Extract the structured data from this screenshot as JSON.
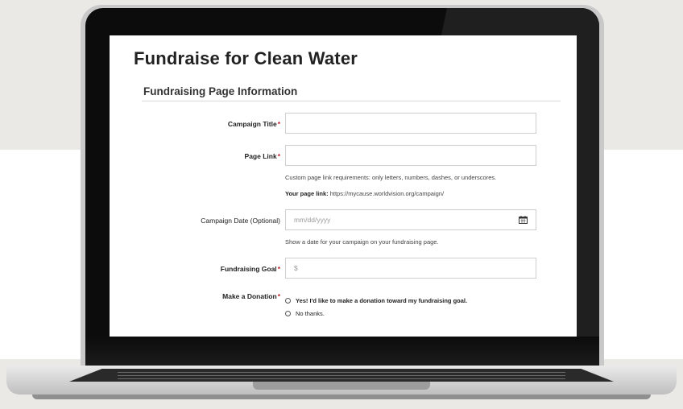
{
  "page": {
    "title": "Fundraise for Clean Water"
  },
  "section": {
    "title": "Fundraising Page Information"
  },
  "form": {
    "campaign_title": {
      "label": "Campaign Title",
      "required_mark": "*",
      "value": ""
    },
    "page_link": {
      "label": "Page Link",
      "required_mark": "*",
      "value": "",
      "help": "Custom page link requirements: only letters, numbers, dashes, or underscores.",
      "your_link_label": "Your page link:",
      "your_link_url": "https://mycause.worldvision.org/campaign/"
    },
    "campaign_date": {
      "label": "Campaign Date (Optional)",
      "placeholder": "mm/dd/yyyy",
      "help": "Show a date for your campaign on your fundraising page.",
      "icon": "calendar-icon"
    },
    "fundraising_goal": {
      "label": "Fundraising Goal",
      "required_mark": "*",
      "placeholder": "$"
    },
    "donation": {
      "label": "Make a Donation",
      "required_mark": "*",
      "options": [
        "Yes! I'd like to make a donation toward my fundraising goal.",
        "No thanks."
      ],
      "selected": null
    }
  },
  "colors": {
    "required": "#c0202a",
    "page_title": "#222222",
    "background": "#ebe9e5"
  }
}
